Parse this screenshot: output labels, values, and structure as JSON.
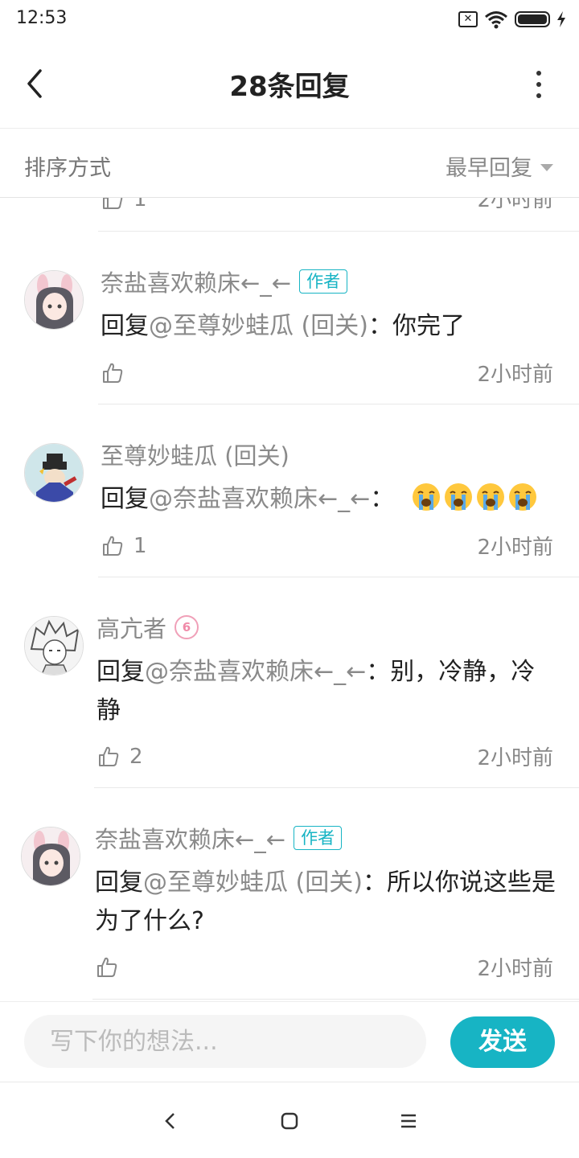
{
  "status_bar": {
    "time": "12:53",
    "icons": [
      "sim-x-icon",
      "wifi-icon",
      "battery-icon",
      "charging-icon"
    ],
    "sim_glyph": "✕"
  },
  "header": {
    "title": "28条回复",
    "icons": [
      "back-icon",
      "more-vertical-icon"
    ]
  },
  "sort": {
    "label": "排序方式",
    "value": "最早回复"
  },
  "partial_reply": {
    "likes": "1",
    "time": "2小时前"
  },
  "replies": [
    {
      "author": "奈盐喜欢赖床←_←",
      "badge": "作者",
      "reply_prefix": "回复",
      "mention": "@至尊妙蛙瓜 (回关)",
      "text": "：你完了",
      "likes": "",
      "time": "2小时前"
    },
    {
      "author": "至尊妙蛙瓜 (回关)",
      "badge": "",
      "reply_prefix": "回复",
      "mention": "@奈盐喜欢赖床←_←",
      "text": "：",
      "emojis": [
        "loudly-crying-face-emoji",
        "loudly-crying-face-emoji",
        "loudly-crying-face-emoji",
        "loudly-crying-face-emoji"
      ],
      "likes": "1",
      "time": "2小时前"
    },
    {
      "author": "高亢者",
      "level_badge": "6",
      "reply_prefix": "回复",
      "mention": "@奈盐喜欢赖床←_←",
      "text": "：别，冷静，冷静",
      "likes": "2",
      "time": "2小时前"
    },
    {
      "author": "奈盐喜欢赖床←_←",
      "badge": "作者",
      "reply_prefix": "回复",
      "mention": "@至尊妙蛙瓜 (回关)",
      "text": "：所以你说这些是为了什么?",
      "likes": "",
      "time": "2小时前"
    }
  ],
  "composer": {
    "placeholder": "写下你的想法...",
    "send_label": "发送"
  },
  "nav": {
    "icons": [
      "nav-back-icon",
      "nav-home-icon",
      "nav-recents-icon"
    ]
  },
  "colors": {
    "accent": "#17b4c4",
    "secondary_text": "#8a8a8a",
    "level_badge": "#f08aa8"
  }
}
